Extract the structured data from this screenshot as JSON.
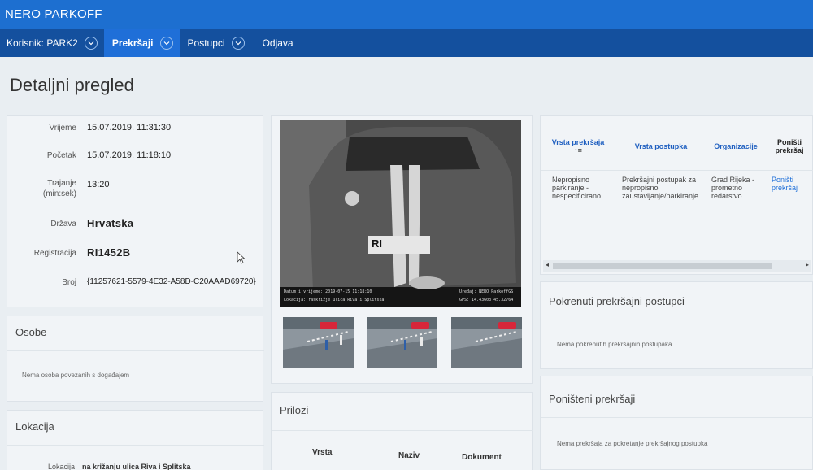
{
  "app": {
    "title": "NERO PARKOFF"
  },
  "nav": {
    "user": "Korisnik: PARK2",
    "violations": "Prekršaji",
    "procedures": "Postupci",
    "logout": "Odjava"
  },
  "page": {
    "title": "Detaljni pregled"
  },
  "details": {
    "time_label": "Vrijeme",
    "time": "15.07.2019. 11:31:30",
    "start_label": "Početak",
    "start": "15.07.2019. 11:18:10",
    "duration_label": "Trajanje (min:sek)",
    "duration": "13:20",
    "country_label": "Država",
    "country": "Hrvatska",
    "plate_label": "Registracija",
    "plate": "RI1452B",
    "number_label": "Broj",
    "number": "{11257621-5579-4E32-A58D-C20AAAD69720}"
  },
  "persons": {
    "title": "Osobe",
    "empty": "Nema osoba povezanih s događajem"
  },
  "location": {
    "title": "Lokacija",
    "label": "Lokacija",
    "value": "na križanju ulica Riva i Splitska"
  },
  "photo": {
    "caption_left_1": "Datum i vrijeme: 2019-07-15 11:18:10",
    "caption_left_2": "Lokacija: raskrižje ulica Riva i Splitska",
    "caption_right_1": "Uređaj: NERO ParkoffGS",
    "caption_right_2": "GPS: 14.43603 45.32764",
    "plate_text": "RI"
  },
  "attachments": {
    "title": "Prilozi",
    "col_type": "Vrsta",
    "col_name": "Naziv",
    "col_doc": "Dokument"
  },
  "violations_table": {
    "col_type": "Vrsta prekršaja",
    "sort_icon": "↑≡",
    "col_procedure": "Vrsta postupka",
    "col_org": "Organizacije",
    "col_cancel": "Poništi prekršaj",
    "row_type": "Nepropisno parkiranje - nespecificirano",
    "row_procedure": "Prekršajni postupak za nepropisno zaustavljanje/parkiranje",
    "row_org": "Grad Rijeka - prometno redarstvo",
    "row_cancel": "Poništi prekršaj"
  },
  "started": {
    "title": "Pokrenuti prekršajni postupci",
    "empty": "Nema pokrenutih prekršajnih postupaka"
  },
  "cancelled": {
    "title": "Poništeni prekršaji",
    "empty": "Nema prekršaja za pokretanje prekršajnog postupka"
  },
  "colors": {
    "titlebar": "#1d6fd0",
    "navbar": "#14509e",
    "nav_active": "#1f6fd8",
    "link": "#1f6fd8"
  }
}
